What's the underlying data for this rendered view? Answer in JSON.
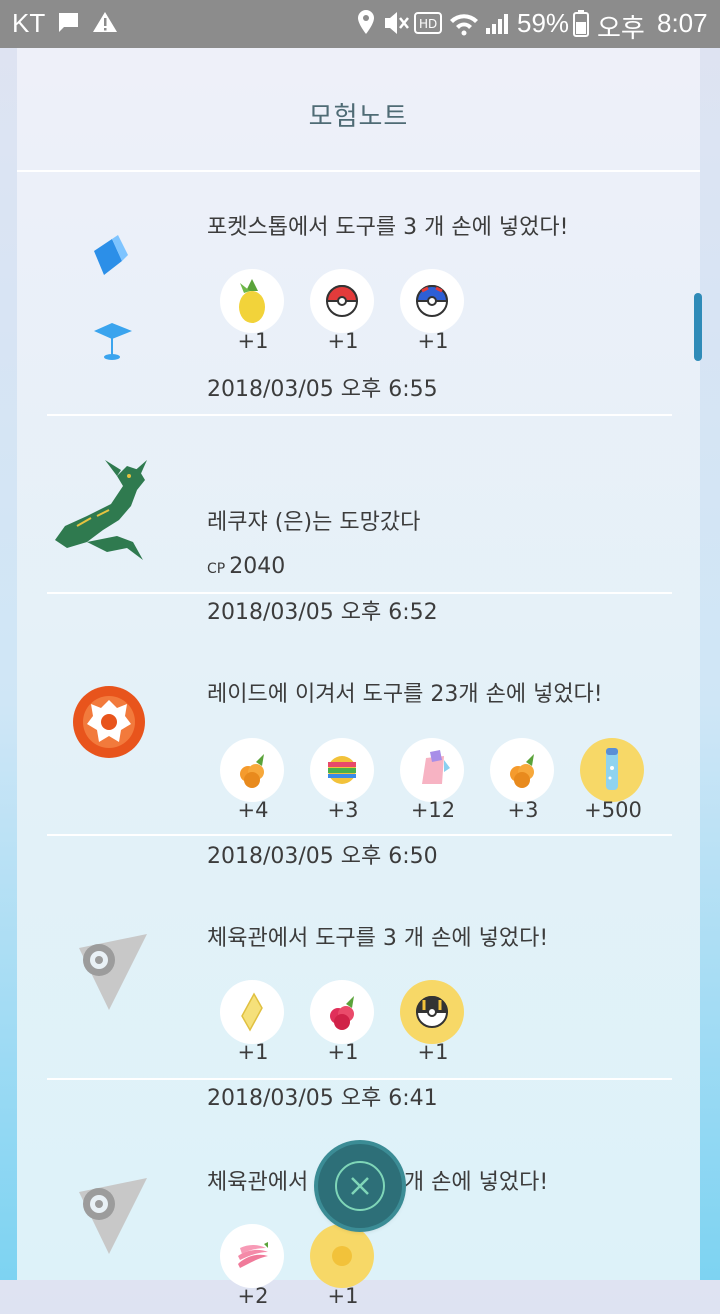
{
  "status": {
    "carrier": "KT",
    "battery": "59%",
    "ampm": "오후",
    "time": "8:07"
  },
  "screen_title": "모험노트",
  "entries": [
    {
      "title": "포켓스톱에서 도구를 3 개 손에 넣었다!",
      "time": "2018/03/05 오후 6:55",
      "items": [
        {
          "icon": "pinap-berry-icon",
          "count": "+1"
        },
        {
          "icon": "poke-ball-icon",
          "count": "+1"
        },
        {
          "icon": "great-ball-icon",
          "count": "+1"
        }
      ]
    },
    {
      "title": "레쿠쟈 (은)는 도망갔다",
      "cp_label": "CP",
      "cp": "2040",
      "time": "2018/03/05 오후 6:52"
    },
    {
      "title": "레이드에 이겨서 도구를 23개 손에 넣었다!",
      "time": "2018/03/05 오후 6:50",
      "items": [
        {
          "icon": "golden-razz-berry-icon",
          "count": "+4"
        },
        {
          "icon": "rare-candy-icon",
          "count": "+3"
        },
        {
          "icon": "tm-icon",
          "count": "+12"
        },
        {
          "icon": "golden-razz-berry-icon",
          "count": "+3"
        },
        {
          "icon": "stardust-icon",
          "count": "+500"
        }
      ]
    },
    {
      "title": "체육관에서 도구를 3 개 손에 넣었다!",
      "time": "2018/03/05 오후 6:41",
      "items": [
        {
          "icon": "revive-icon",
          "count": "+1"
        },
        {
          "icon": "razz-berry-icon",
          "count": "+1"
        },
        {
          "icon": "ultra-ball-icon",
          "count": "+1"
        }
      ]
    },
    {
      "title": "체육관에서 도구를 3 개 손에 넣었다!",
      "items": [
        {
          "icon": "nanab-berry-icon",
          "count": "+2"
        },
        {
          "icon": "gold-item-icon",
          "count": "+1"
        }
      ]
    }
  ]
}
